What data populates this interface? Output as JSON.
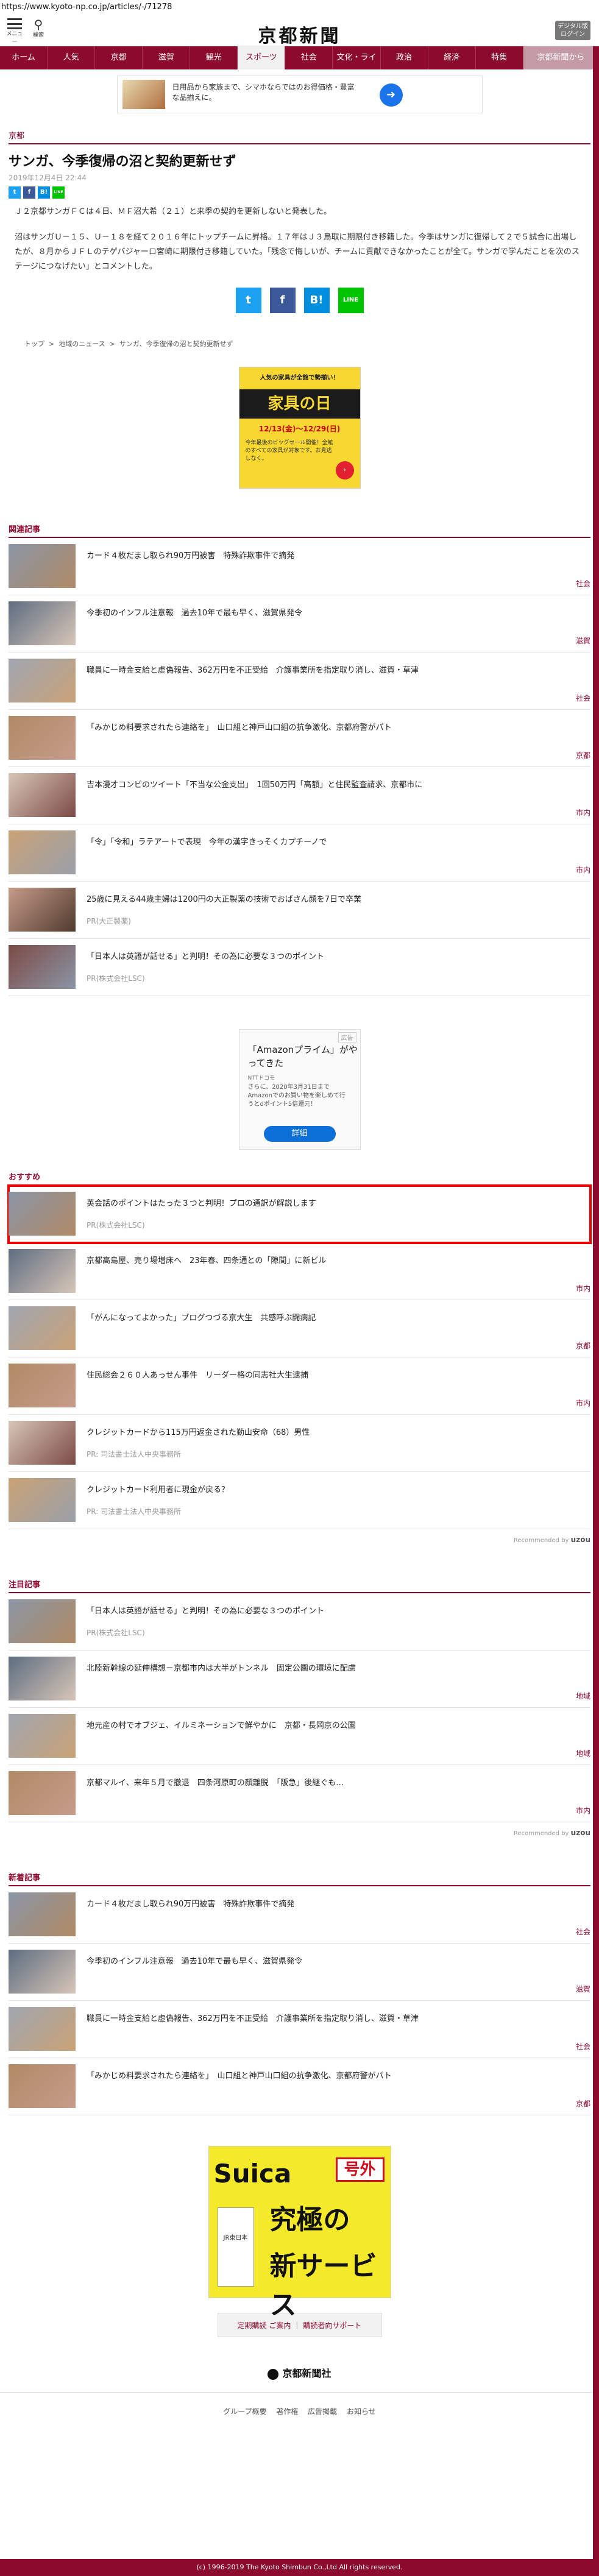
{
  "browser": {
    "url": "https://www.kyoto-np.co.jp/articles/-/71278"
  },
  "header": {
    "menu_label": "メニュー",
    "search_label": "検索",
    "logo": "京都新聞",
    "digital_label": "デジタル版ログイン"
  },
  "nav": {
    "items": [
      "ホーム",
      "人気",
      "京都",
      "滋賀",
      "観光",
      "スポーツ",
      "社会",
      "文化・ライフ",
      "政治",
      "経済",
      "特集",
      "京都新聞から"
    ],
    "active": "スポーツ"
  },
  "top_ad": {
    "text": "日用品から家族まで、シマホならではのお得価格・豊富な品揃えに。"
  },
  "article": {
    "section": "京都",
    "title": "サンガ、今季復帰の沼と契約更新せず",
    "date": "2019年12月4日 22:44",
    "paragraphs": [
      "Ｊ２京都サンガＦＣは４日、ＭＦ沼大希（２１）と来季の契約を更新しないと発表した。",
      "沼はサンガＵ－１５、Ｕ－１８を経て２０１６年にトップチームに昇格。１７年はＪ３鳥取に期限付き移籍した。今季はサンガに復帰して２で５試合に出場したが、８月からＪＦＬのテゲバジャーロ宮崎に期限付き移籍していた。「残念で悔しいが、チームに貢献できなかったことが全て。サンガで学んだことを次のステージにつなげたい」とコメントした。"
    ],
    "share_small": [
      "t",
      "f",
      "B!",
      "LINE"
    ],
    "share_large": [
      "t",
      "f",
      "B!",
      "LINE"
    ]
  },
  "breadcrumb": [
    "トップ",
    "地域のニュース",
    "サンガ、今季復帰の沼と契約更新せず"
  ],
  "sale_ad": {
    "top": "人気の家具が全館で勢揃い！",
    "headline": "家具の日",
    "sub": "12/13(金)〜12/29(日)",
    "desc": "今年最後のビッグセール開催！全館のすべての家具が対象です。お見逃しなく。",
    "go": "›"
  },
  "related": {
    "heading": "関連記事",
    "items": [
      {
        "title": "カード４枚だまし取られ90万円被害　特殊詐欺事件で摘発",
        "sub": "",
        "cat": "社会"
      },
      {
        "title": "今季初のインフル注意報　過去10年で最も早く、滋賀県発令",
        "sub": "",
        "cat": "滋賀"
      },
      {
        "title": "職員に一時金支給と虚偽報告、362万円を不正受給　介護事業所を指定取り消し、滋賀・草津",
        "sub": "",
        "cat": "社会"
      },
      {
        "title": "「みかじめ料要求されたら連絡を」　山口組と神戸山口組の抗争激化、京都府警がパト",
        "sub": "",
        "cat": "京都"
      },
      {
        "title": "吉本漫才コンビのツイート「不当な公金支出」　1回50万円「高額」と住民監査請求、京都市に",
        "sub": "",
        "cat": "市内"
      },
      {
        "title": "「令」「令和」ラテアートで表現　今年の漢字きっそくカプチーノで",
        "sub": "",
        "cat": "市内"
      },
      {
        "title": "25歳に見える44歳主婦は1200円の大正製薬の技術でおばさん顔を7日で卒業",
        "sub": "PR(大正製薬)",
        "cat": ""
      },
      {
        "title": "「日本人は英語が話せる」と判明！その為に必要な３つのポイント",
        "sub": "PR(株式会社LSC)",
        "cat": ""
      }
    ]
  },
  "mid_ad": {
    "badge": "広告",
    "title": "「Amazonプライム」がやってきた",
    "small": "NTTドコモ",
    "desc": "さらに、2020年3月31日までAmazonでのお買い物を楽しめて行うとdポイント5倍還元！",
    "button": "詳細"
  },
  "recommend": {
    "heading": "おすすめ",
    "items": [
      {
        "title": "英会話のポイントはたった３つと判明！プロの通訳が解説します",
        "sub": "PR(株式会社LSC)",
        "cat": ""
      },
      {
        "title": "京都高島屋、売り場増床へ　23年春、四条通との「隙間」に新ビル",
        "sub": "",
        "cat": "市内"
      },
      {
        "title": "「がんになってよかった」ブログつづる京大生　共感呼ぶ闘病記",
        "sub": "",
        "cat": "京都"
      },
      {
        "title": "住民総会２６０人あっせん事件　リーダー格の同志社大生逮捕",
        "sub": "",
        "cat": "市内"
      },
      {
        "title": "クレジットカードから115万円返金された勤山安命（68）男性",
        "sub": "PR: 司法書士法人中央事務所",
        "cat": ""
      },
      {
        "title": "クレジットカード利用者に現金が戻る？",
        "sub": "PR: 司法書士法人中央事務所",
        "cat": ""
      }
    ],
    "credit_label": "Recommended by",
    "credit_brand": "uzou"
  },
  "featured": {
    "heading": "注目記事",
    "items": [
      {
        "title": "「日本人は英語が話せる」と判明！その為に必要な３つのポイント",
        "sub": "PR(株式会社LSC)",
        "cat": ""
      },
      {
        "title": "北陸新幹線の延伸構想－京都市内は大半がトンネル　固定公園の環境に配慮",
        "sub": "",
        "cat": "地域"
      },
      {
        "title": "地元産の村でオブジェ、イルミネーションで鮮やかに　京都・長岡京の公園",
        "sub": "",
        "cat": "地域"
      },
      {
        "title": "京都マルイ、来年５月で撤退　四条河原町の顔離脱　「阪急」後継ぐも…",
        "sub": "",
        "cat": "市内"
      }
    ],
    "credit_label": "Recommended by",
    "credit_brand": "uzou"
  },
  "latest": {
    "heading": "新着記事",
    "items": [
      {
        "title": "カード４枚だまし取られ90万円被害　特殊詐欺事件で摘発",
        "sub": "",
        "cat": "社会"
      },
      {
        "title": "今季初のインフル注意報　過去10年で最も早く、滋賀県発令",
        "sub": "",
        "cat": "滋賀"
      },
      {
        "title": "職員に一時金支給と虚偽報告、362万円を不正受給　介護事業所を指定取り消し、滋賀・草津",
        "sub": "",
        "cat": "社会"
      },
      {
        "title": "「みかじめ料要求されたら連絡を」　山口組と神戸山口組の抗争激化、京都府警がパト",
        "sub": "",
        "cat": "京都"
      }
    ]
  },
  "suica_ad": {
    "brand": "Suica",
    "badge": "号外",
    "line1": "究極の",
    "line2": "新サービス",
    "side": "JR東日本"
  },
  "footer": {
    "links": [
      "定期購読 ご案内",
      "購読者向サポート"
    ],
    "logo": "京都新聞社",
    "nav": [
      "グループ概要",
      "著作権",
      "広告掲載",
      "お知らせ"
    ],
    "copyright": "(c) 1996-2019 The Kyoto Shimbun Co.,Ltd All rights reserved."
  },
  "colors": {
    "brand": "#8c0a2e",
    "highlight": "#e00000"
  }
}
